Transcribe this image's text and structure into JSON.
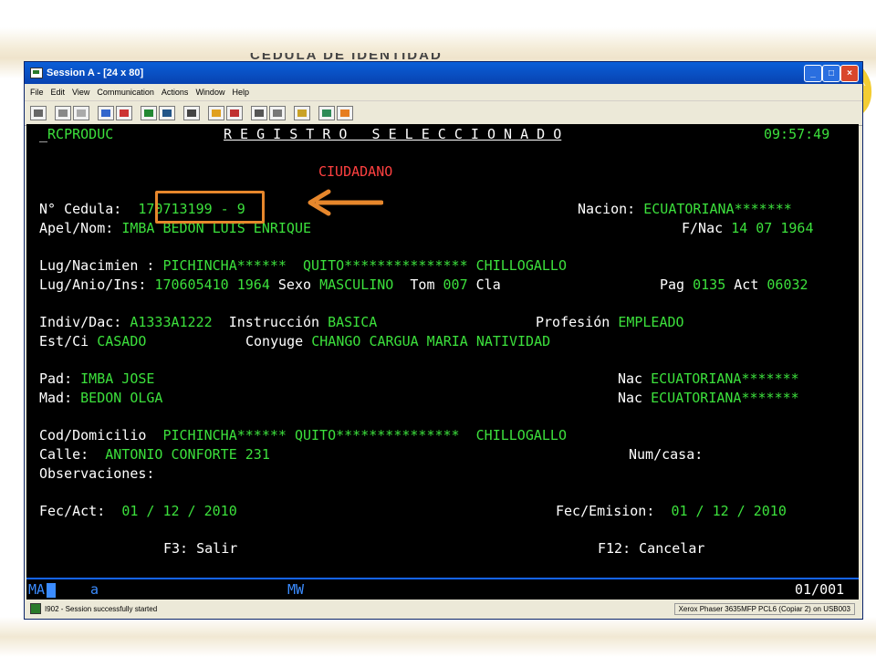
{
  "slide": {
    "title_ghost": "CEDULA DE IDENTIDAD"
  },
  "window": {
    "title": "Session A - [24 x 80]",
    "menu": [
      "File",
      "Edit",
      "View",
      "Communication",
      "Actions",
      "Window",
      "Help"
    ],
    "controls": {
      "minimize": "_",
      "maximize": "□",
      "close": "×"
    }
  },
  "terminal": {
    "header": {
      "program": "RCPRODUC",
      "screen_title": "R E G I S T R O   S E L E C C I O N A D O",
      "time": "09:57:49"
    },
    "section": "CIUDADANO",
    "cedula": {
      "label": "N° Cedula:",
      "number": "170713199",
      "sep": " - ",
      "check_digit": "9"
    },
    "nacion": {
      "label": "Nacion:",
      "value": "ECUATORIANA*******"
    },
    "apel_nom": {
      "label": "Apel/Nom:",
      "value": "IMBA BEDON LUIS ENRIQUE"
    },
    "f_nac": {
      "label": "F/Nac",
      "value": "14 07 1964"
    },
    "lug_nacimien": {
      "label": "Lug/Nacimien :",
      "province": "PICHINCHA******",
      "canton": "QUITO***************",
      "parish": "CHILLOGALLO"
    },
    "lug_anio_ins": {
      "label": "Lug/Anio/Ins:",
      "value": "170605410 1964"
    },
    "sexo": {
      "label": "Sexo",
      "value": "MASCULINO"
    },
    "tom": {
      "label": "Tom",
      "value": "007"
    },
    "cla": {
      "label": "Cla",
      "value": ""
    },
    "pag": {
      "label": "Pag",
      "value": "0135"
    },
    "act": {
      "label": "Act",
      "value": "06032"
    },
    "indiv_dac": {
      "label": "Indiv/Dac:",
      "value": "A1333A1222"
    },
    "instruccion": {
      "label": "Instrucción",
      "value": "BASICA"
    },
    "profesion": {
      "label": "Profesión",
      "value": "EMPLEADO"
    },
    "est_ci": {
      "label": "Est/Ci",
      "value": "CASADO"
    },
    "conyuge": {
      "label": "Conyuge",
      "value": "CHANGO CARGUA MARIA NATIVIDAD"
    },
    "pad": {
      "label": "Pad:",
      "value": "IMBA JOSE",
      "nac_label": "Nac",
      "nac_value": "ECUATORIANA*******"
    },
    "mad": {
      "label": "Mad:",
      "value": "BEDON OLGA",
      "nac_label": "Nac",
      "nac_value": "ECUATORIANA*******"
    },
    "cod_domicilio": {
      "label": "Cod/Domicilio",
      "province": "PICHINCHA******",
      "canton": "QUITO***************",
      "parish": "CHILLOGALLO"
    },
    "calle": {
      "label": "Calle:",
      "value": "ANTONIO CONFORTE 231"
    },
    "num_casa": {
      "label": "Num/casa:",
      "value": ""
    },
    "observaciones": {
      "label": "Observaciones:",
      "value": ""
    },
    "fec_act": {
      "label": "Fec/Act:",
      "value": "01 / 12 / 2010"
    },
    "fec_emision": {
      "label": "Fec/Emision:",
      "value": "01 / 12 / 2010"
    },
    "f3": {
      "key": "F3:",
      "label": "Salir"
    },
    "f12": {
      "key": "F12:",
      "label": "Cancelar"
    },
    "oia": {
      "ma": "MA",
      "a": "a",
      "mw": "MW",
      "position": "01/001"
    }
  },
  "statusbar": {
    "message": "I902 - Session successfully started",
    "printer": "Xerox Phaser 3635MFP PCL6 (Copiar 2) on USB003"
  },
  "colors": {
    "terminal_bg": "#000000",
    "field_green": "#3ce03c",
    "heading_red": "#ff4040",
    "highlight_orange": "#e7872c",
    "titlebar_blue": "#0842b0"
  }
}
